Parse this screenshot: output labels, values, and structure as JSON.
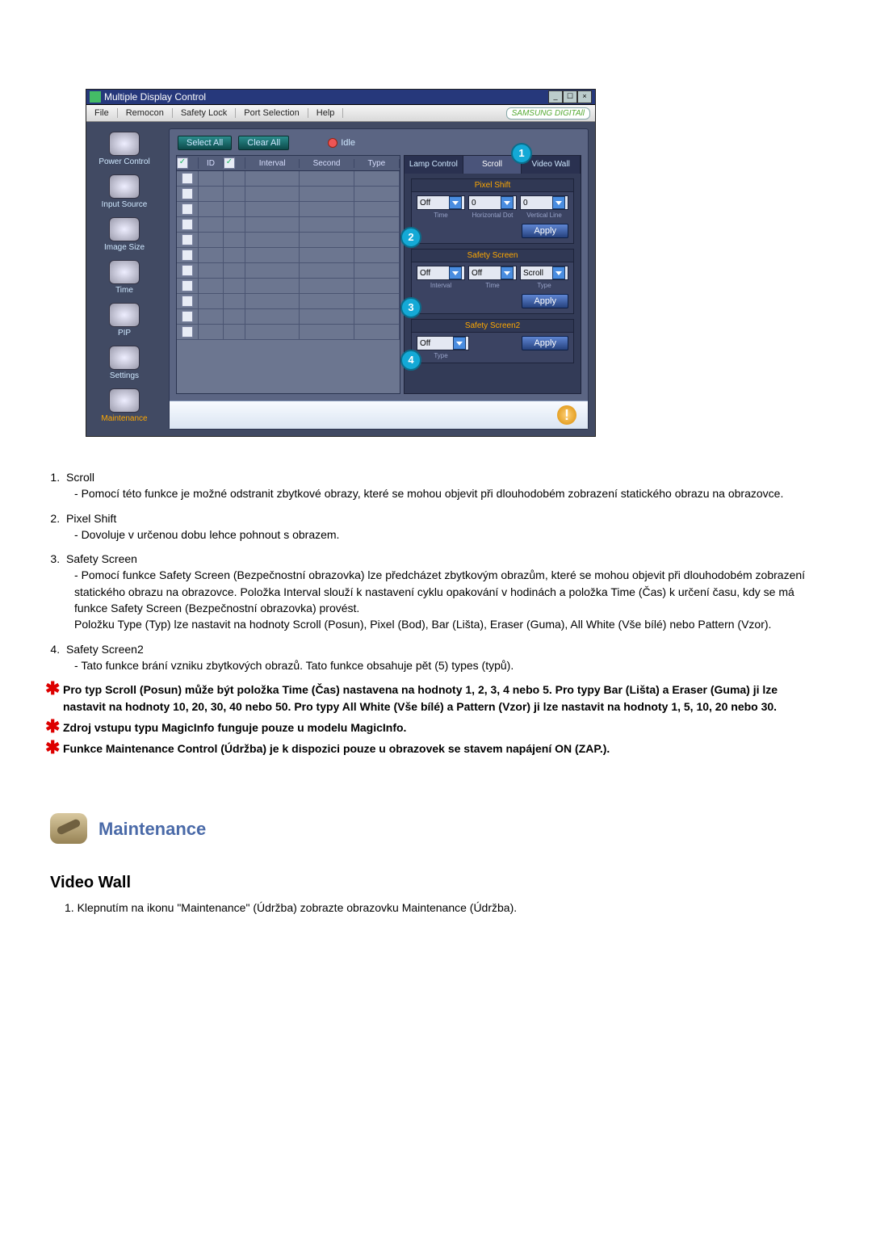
{
  "window": {
    "title": "Multiple Display Control",
    "brand": "SAMSUNG DIGITAll"
  },
  "menu": {
    "items": [
      "File",
      "Remocon",
      "Safety Lock",
      "Port Selection",
      "Help"
    ]
  },
  "sidebar": [
    {
      "name": "power-control",
      "label": "Power Control"
    },
    {
      "name": "input-source",
      "label": "Input Source"
    },
    {
      "name": "image-size",
      "label": "Image Size"
    },
    {
      "name": "time",
      "label": "Time"
    },
    {
      "name": "pip",
      "label": "PIP"
    },
    {
      "name": "settings",
      "label": "Settings"
    },
    {
      "name": "maintenance",
      "label": "Maintenance"
    }
  ],
  "actions": {
    "select_all": "Select All",
    "clear_all": "Clear All",
    "idle_label": "Idle"
  },
  "grid": {
    "headers": {
      "checkbox": "",
      "id": "ID",
      "checkbox2": "",
      "interval": "Interval",
      "second": "Second",
      "type": "Type"
    },
    "header_chk_on": true,
    "row_count": 11
  },
  "right_tabs": [
    "Lamp Control",
    "Scroll",
    "Video Wall"
  ],
  "right_active_tab": 1,
  "callouts": {
    "c1": "1",
    "c2": "2",
    "c3": "3",
    "c4": "4"
  },
  "pixel_shift": {
    "title": "Pixel Shift",
    "time_value": "Off",
    "hdot_value": "0",
    "vline_value": "0",
    "labels": {
      "time": "Time",
      "hdot": "Horizontal Dot",
      "vline": "Vertical Line"
    },
    "apply": "Apply"
  },
  "safety_screen": {
    "title": "Safety Screen",
    "interval_value": "Off",
    "time_value": "Off",
    "type_value": "Scroll",
    "labels": {
      "interval": "Interval",
      "time": "Time",
      "type": "Type"
    },
    "apply": "Apply"
  },
  "safety_screen2": {
    "title": "Safety Screen2",
    "type_value": "Off",
    "labels": {
      "type": "Type"
    },
    "apply": "Apply"
  },
  "doc": {
    "items": [
      {
        "title": "Scroll",
        "body": "Pomocí této funkce je možné odstranit zbytkové obrazy, které se mohou objevit při dlouhodobém zobrazení statického obrazu na obrazovce."
      },
      {
        "title": "Pixel Shift",
        "body": "Dovoluje v určenou dobu lehce pohnout s obrazem."
      },
      {
        "title": "Safety Screen",
        "body": "Pomocí funkce Safety Screen (Bezpečnostní obrazovka) lze předcházet zbytkovým obrazům, které se mohou objevit při dlouhodobém zobrazení statického obrazu na obrazovce.  Položka Interval slouží k nastavení cyklu opakování v hodinách a položka Time (Čas) k určení času, kdy se má funkce Safety Screen (Bezpečnostní obrazovka) provést.",
        "body2": "Položku Type (Typ) lze nastavit na hodnoty Scroll (Posun), Pixel (Bod), Bar (Lišta), Eraser (Guma), All White (Vše bílé) nebo Pattern (Vzor)."
      },
      {
        "title": "Safety Screen2",
        "body": "Tato funkce brání vzniku zbytkových obrazů. Tato funkce obsahuje pět (5) types (typů)."
      }
    ],
    "stars": [
      "Pro typ Scroll (Posun) může být položka Time (Čas) nastavena na hodnoty 1, 2, 3, 4 nebo 5. Pro typy Bar (Lišta) a Eraser (Guma) ji lze nastavit na hodnoty 10, 20, 30, 40 nebo 50. Pro typy All White (Vše bílé) a Pattern (Vzor) ji lze nastavit na hodnoty 1, 5, 10, 20 nebo 30.",
      "Zdroj vstupu typu MagicInfo funguje pouze u modelu MagicInfo.",
      "Funkce Maintenance Control (Údržba) je k dispozici pouze u obrazovek se stavem napájení ON (ZAP.)."
    ],
    "maintenance_heading": "Maintenance",
    "video_wall_heading": "Video Wall",
    "video_wall_instruction_num": "1.",
    "video_wall_instruction": "Klepnutím na ikonu \"Maintenance\" (Údržba) zobrazte obrazovku Maintenance (Údržba)."
  }
}
